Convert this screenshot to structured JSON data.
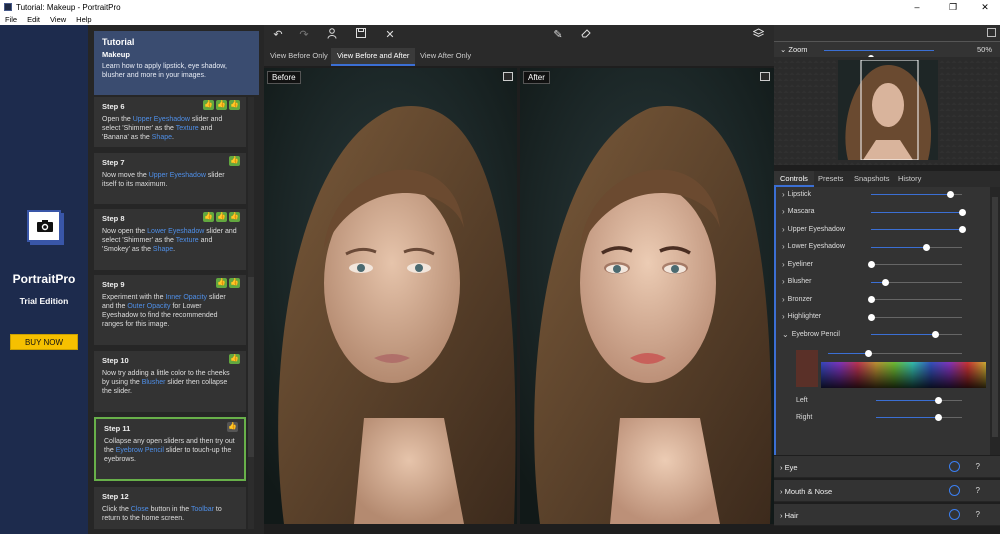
{
  "window": {
    "title": "Tutorial: Makeup - PortraitPro",
    "min": "–",
    "max": "❐",
    "close": "✕"
  },
  "menu": [
    "File",
    "Edit",
    "View",
    "Help"
  ],
  "brand": {
    "name": "PortraitPro",
    "edition": "Trial Edition",
    "buy": "BUY NOW"
  },
  "tutorial": {
    "title": "Tutorial",
    "subtitle": "Makeup",
    "desc": "Learn how to apply lipstick, eye shadow, blusher and more in your images."
  },
  "steps": [
    {
      "title": "Step 6",
      "thumbs": 3,
      "active": false,
      "parts": [
        "Open the ",
        "Upper Eyeshadow",
        " slider and select 'Shimmer' as the ",
        "Texture",
        " and 'Banana' as the ",
        "Shape",
        "."
      ]
    },
    {
      "title": "Step 7",
      "thumbs": 1,
      "active": false,
      "parts": [
        "Now move the ",
        "Upper Eyeshadow",
        " slider itself to its maximum."
      ]
    },
    {
      "title": "Step 8",
      "thumbs": 3,
      "active": false,
      "parts": [
        "Now open the ",
        "Lower Eyeshadow",
        " slider and select 'Shimmer' as the ",
        "Texture",
        " and 'Smokey' as the ",
        "Shape",
        "."
      ]
    },
    {
      "title": "Step 9",
      "thumbs": 2,
      "active": false,
      "parts": [
        "Experiment with the ",
        "Inner Opacity",
        " slider and the ",
        "Outer Opacity",
        " for Lower Eyeshadow to find the recommended ranges for this image."
      ]
    },
    {
      "title": "Step 10",
      "thumbs": 1,
      "active": false,
      "parts": [
        "Now try adding a little color to the cheeks by using the ",
        "Blusher",
        " slider then collapse the slider."
      ]
    },
    {
      "title": "Step 11",
      "thumbs": 1,
      "active": true,
      "parts": [
        "Collapse any open sliders and then try out the ",
        "Eyebrow Pencil",
        " slider to touch-up the eyebrows."
      ]
    },
    {
      "title": "Step 12",
      "thumbs": 0,
      "active": false,
      "parts": [
        "Click the ",
        "Close",
        " button in the ",
        "Toolbar",
        " to return to the home screen."
      ]
    }
  ],
  "view_tabs": [
    {
      "label": "View Before Only",
      "selected": false
    },
    {
      "label": "View Before and After",
      "selected": true
    },
    {
      "label": "View After Only",
      "selected": false
    }
  ],
  "panels": {
    "before": "Before",
    "after": "After"
  },
  "zoom": {
    "label": "Zoom",
    "value": "50%",
    "level": 0.5
  },
  "control_tabs": [
    {
      "label": "Controls",
      "selected": true
    },
    {
      "label": "Presets",
      "selected": false
    },
    {
      "label": "Snapshots",
      "selected": false
    },
    {
      "label": "History",
      "selected": false
    }
  ],
  "controls": [
    {
      "label": "Lipstick",
      "value": 0.87
    },
    {
      "label": "Mascara",
      "value": 1.0
    },
    {
      "label": "Upper Eyeshadow",
      "value": 1.0
    },
    {
      "label": "Lower Eyeshadow",
      "value": 0.6
    },
    {
      "label": "Eyeliner",
      "value": 0.0
    },
    {
      "label": "Blusher",
      "value": 0.15
    },
    {
      "label": "Bronzer",
      "value": 0.0
    },
    {
      "label": "Highlighter",
      "value": 0.0
    },
    {
      "label": "Eyebrow Pencil",
      "value": 0.7,
      "expanded": true
    }
  ],
  "eyebrow": {
    "strength": 0.3,
    "swatch_color": "#5a3028",
    "left_label": "Left",
    "left_value": 0.72,
    "right_label": "Right",
    "right_value": 0.72
  },
  "sections": [
    {
      "label": "Eye"
    },
    {
      "label": "Mouth & Nose"
    },
    {
      "label": "Hair"
    }
  ],
  "colors": {
    "accent": "#3b6fd4",
    "buy": "#f6c000",
    "step_active": "#68b04a",
    "link": "#4f8fe8"
  }
}
